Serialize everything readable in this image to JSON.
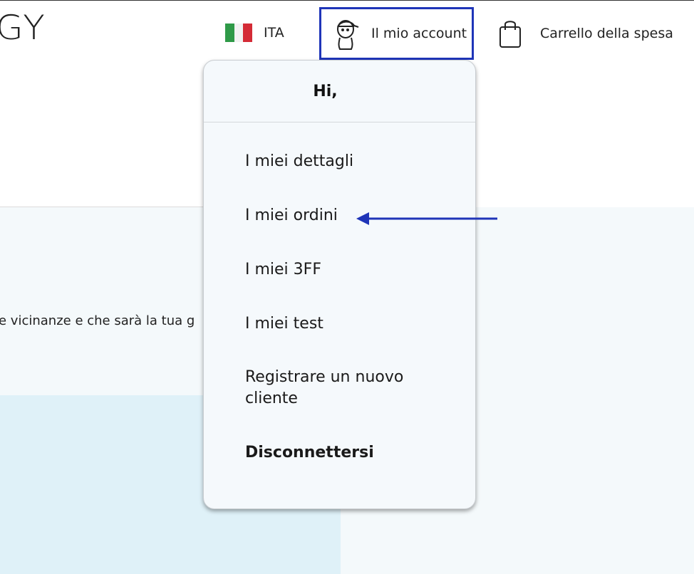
{
  "header": {
    "logo_text": "GY",
    "language": {
      "label": "ITA",
      "flag_colors": [
        "#2f9a48",
        "#f2f2f2",
        "#d42b36"
      ]
    },
    "account": {
      "label": "Il mio account",
      "highlight_color": "#1f35b8"
    },
    "cart": {
      "label": "Carrello della spesa"
    }
  },
  "background": {
    "partial_text": "e vicinanze e che sarà la tua g"
  },
  "dropdown": {
    "greeting": "Hi,",
    "items": [
      {
        "label": "I miei dettagli"
      },
      {
        "label": "I miei ordini"
      },
      {
        "label": "I miei 3FF"
      },
      {
        "label": "I miei test"
      },
      {
        "label": "Registrare un nuovo cliente"
      },
      {
        "label": "Disconnettersi"
      }
    ]
  },
  "annotation": {
    "arrow_color": "#1f35b8"
  }
}
